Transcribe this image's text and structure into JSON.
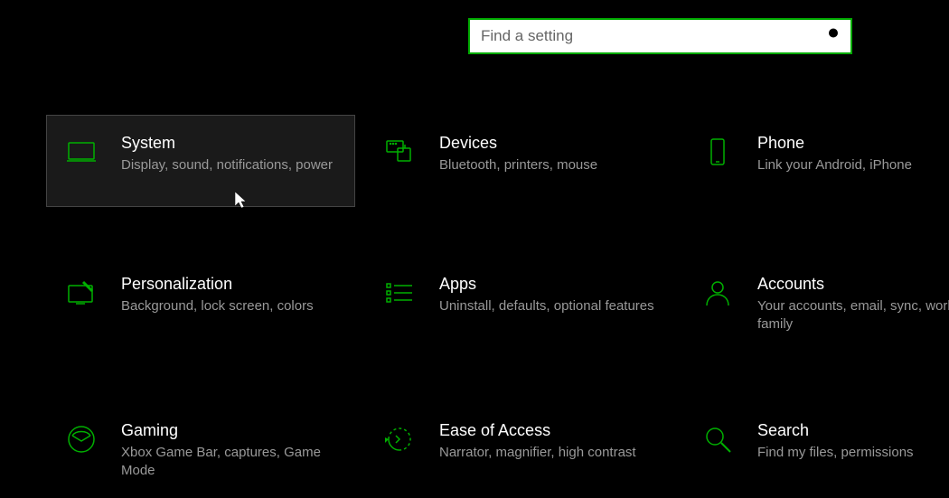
{
  "accent": "#00b000",
  "search": {
    "placeholder": "Find a setting",
    "value": ""
  },
  "tiles": [
    {
      "id": "system",
      "title": "System",
      "subtitle": "Display, sound, notifications, power",
      "hovered": true
    },
    {
      "id": "devices",
      "title": "Devices",
      "subtitle": "Bluetooth, printers, mouse",
      "hovered": false
    },
    {
      "id": "phone",
      "title": "Phone",
      "subtitle": "Link your Android, iPhone",
      "hovered": false
    },
    {
      "id": "personalization",
      "title": "Personalization",
      "subtitle": "Background, lock screen, colors",
      "hovered": false
    },
    {
      "id": "apps",
      "title": "Apps",
      "subtitle": "Uninstall, defaults, optional features",
      "hovered": false
    },
    {
      "id": "accounts",
      "title": "Accounts",
      "subtitle": "Your accounts, email, sync, work, family",
      "hovered": false
    },
    {
      "id": "gaming",
      "title": "Gaming",
      "subtitle": "Xbox Game Bar, captures, Game Mode",
      "hovered": false
    },
    {
      "id": "ease-of-access",
      "title": "Ease of Access",
      "subtitle": "Narrator, magnifier, high contrast",
      "hovered": false
    },
    {
      "id": "search",
      "title": "Search",
      "subtitle": "Find my files, permissions",
      "hovered": false
    }
  ]
}
